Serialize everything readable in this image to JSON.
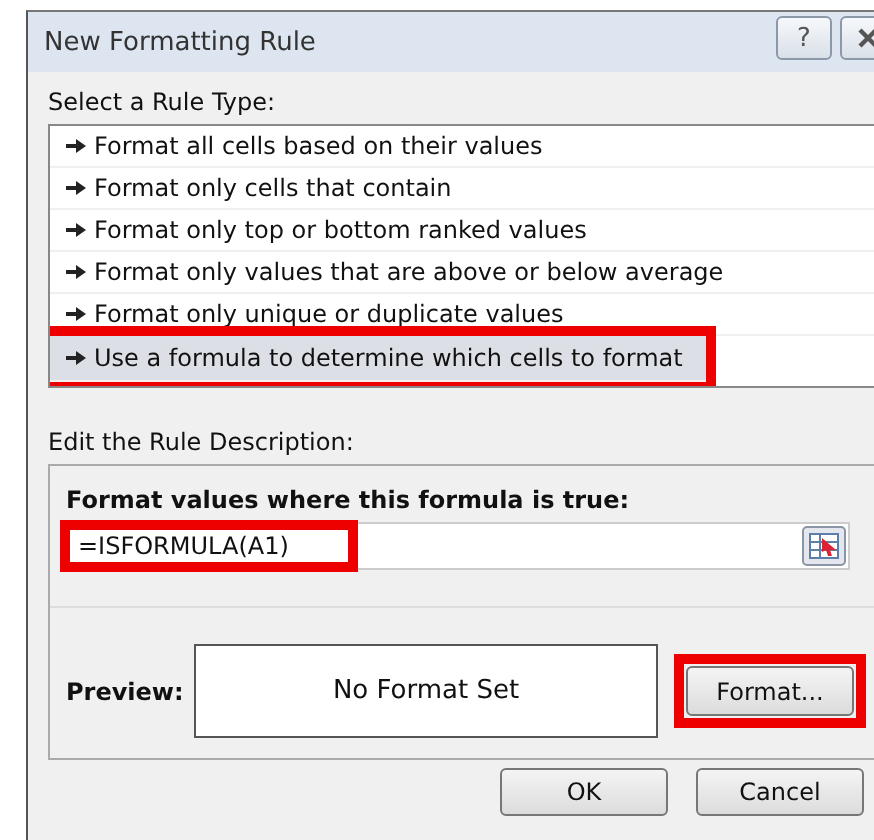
{
  "window": {
    "title": "New Formatting Rule"
  },
  "title_buttons": [
    {
      "kind": "help",
      "label": "?"
    },
    {
      "kind": "close"
    }
  ],
  "rule_type": {
    "label": "Select a Rule Type:",
    "items": [
      {
        "label": "Format all cells based on their values",
        "selected": false,
        "highlighted": false
      },
      {
        "label": "Format only cells that contain",
        "selected": false,
        "highlighted": false
      },
      {
        "label": "Format only top or bottom ranked values",
        "selected": false,
        "highlighted": false
      },
      {
        "label": "Format only values that are above or below average",
        "selected": false,
        "highlighted": false
      },
      {
        "label": "Format only unique or duplicate values",
        "selected": false,
        "highlighted": false
      },
      {
        "label": "Use a formula to determine which cells to format",
        "selected": true,
        "highlighted": true
      }
    ]
  },
  "description": {
    "label": "Edit the Rule Description:",
    "formula_label": "Format values where this formula is true:",
    "formula": {
      "value": "=ISFORMULA(A1)",
      "highlighted": true
    },
    "preview_label": "Preview:",
    "preview_text": "No Format Set",
    "format_button": {
      "label": "Format...",
      "highlighted": true
    }
  },
  "buttons": [
    {
      "label": "OK"
    },
    {
      "label": "Cancel"
    }
  ]
}
